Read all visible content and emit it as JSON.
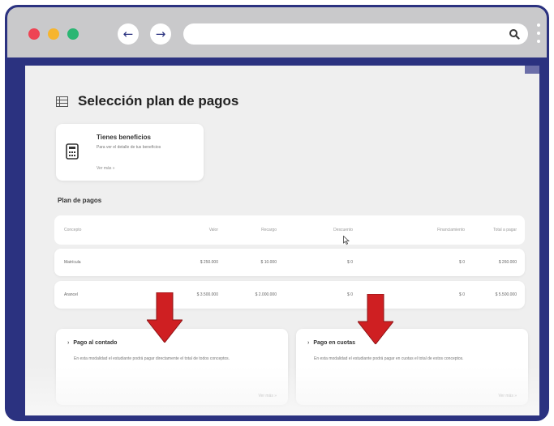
{
  "browser": {
    "back_icon": "←",
    "forward_icon": "→",
    "address": "",
    "icons": [
      "back-arrow-icon",
      "forward-arrow-icon",
      "search-icon",
      "kebab-menu-icon"
    ],
    "colors": {
      "frame": "#2b3280",
      "dot_red": "#ee4454",
      "dot_yellow": "#f6b52e",
      "dot_green": "#2bb673"
    }
  },
  "page": {
    "title": "Selección plan de pagos",
    "benefits_card": {
      "title": "Tienes beneficios",
      "description": "Para ver el detalle de tus beneficios",
      "link": "Ver más »"
    },
    "plan_section_title": "Plan de pagos",
    "table": {
      "headers": [
        "Concepto",
        "Valor",
        "Recargo",
        "Descuento",
        "Financiamiento",
        "Total a pagar"
      ],
      "rows": [
        {
          "cells": [
            "Matrícula",
            "$ 250.000",
            "$ 10.000",
            "$ 0",
            "$ 0",
            "$ 260.000"
          ]
        },
        {
          "cells": [
            "Arancel",
            "$ 3.500.000",
            "$ 2.000.000",
            "$ 0",
            "$ 0",
            "$ 5.500.000"
          ]
        }
      ]
    },
    "payment_options": [
      {
        "title": "Pago al contado",
        "description": "En esta modalidad el estudiante podrá pagar directamente el total de todos conceptos.",
        "link": "Ver más »"
      },
      {
        "title": "Pago en cuotas",
        "description": "En esta modalidad el estudiante podrá pagar en cuotas el total de estos conceptos.",
        "link": "Ver más »"
      }
    ],
    "annotation_color": "#cf1f22"
  }
}
